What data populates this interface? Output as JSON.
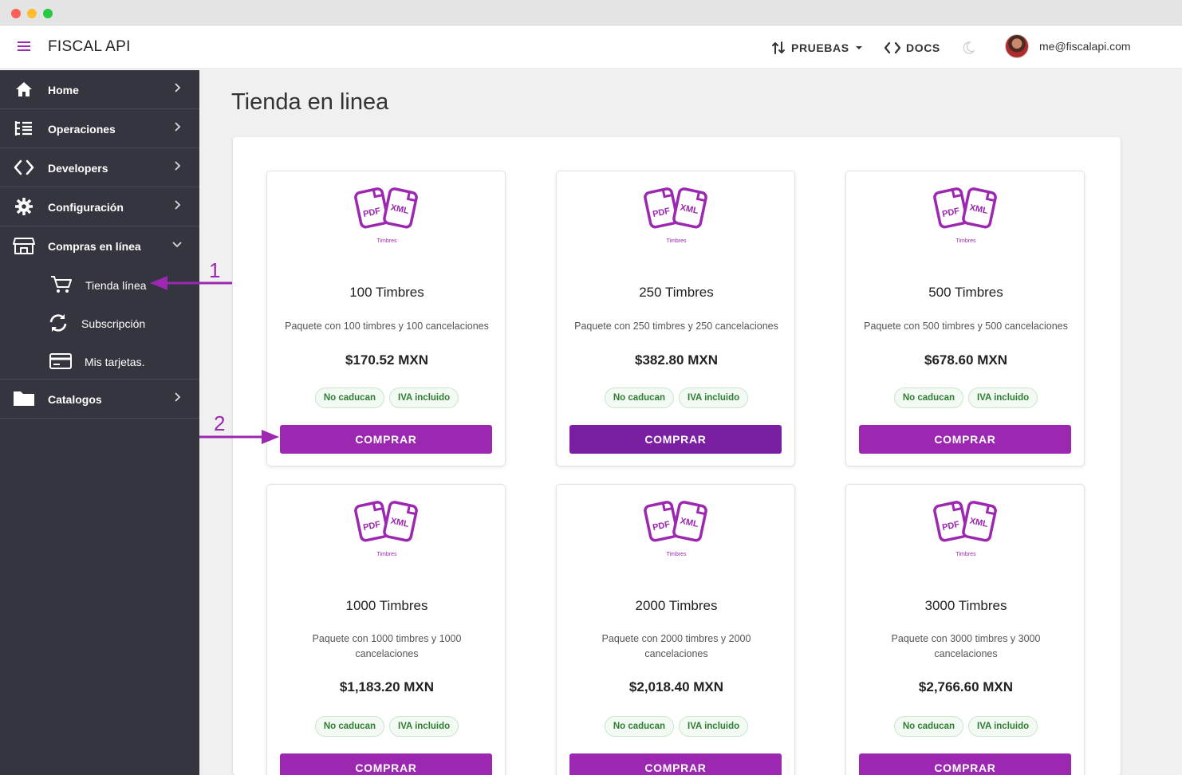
{
  "header": {
    "app_title": "FISCAL API",
    "env_label": "PRUEBAS",
    "docs_label": "DOCS",
    "user_email": "me@fiscalapi.com"
  },
  "sidebar": {
    "items": [
      {
        "label": "Home",
        "icon": "home-icon"
      },
      {
        "label": "Operaciones",
        "icon": "list-icon"
      },
      {
        "label": "Developers",
        "icon": "code-icon"
      },
      {
        "label": "Configuración",
        "icon": "gear-icon"
      },
      {
        "label": "Compras en línea",
        "icon": "store-icon",
        "expanded": true
      },
      {
        "label": "Catalogos",
        "icon": "folder-icon"
      }
    ],
    "subitems": [
      {
        "label": "Tienda línea",
        "icon": "cart-icon",
        "active": true
      },
      {
        "label": "Subscripción",
        "icon": "sync-icon"
      },
      {
        "label": "Mis tarjetas.",
        "icon": "credit-card-icon"
      }
    ]
  },
  "page": {
    "title": "Tienda en linea"
  },
  "products": [
    {
      "name": "100 Timbres",
      "description": "Paquete con 100 timbres y 100 cancelaciones",
      "price": "$170.52 MXN"
    },
    {
      "name": "250 Timbres",
      "description": "Paquete con 250 timbres y 250 cancelaciones",
      "price": "$382.80 MXN"
    },
    {
      "name": "500 Timbres",
      "description": "Paquete con 500 timbres y 500 cancelaciones",
      "price": "$678.60 MXN"
    },
    {
      "name": "1000 Timbres",
      "description": "Paquete con 1000 timbres y 1000 cancelaciones",
      "price": "$1,183.20 MXN"
    },
    {
      "name": "2000 Timbres",
      "description": "Paquete con 2000 timbres y 2000 cancelaciones",
      "price": "$2,018.40 MXN"
    },
    {
      "name": "3000 Timbres",
      "description": "Paquete con 3000 timbres y 3000 cancelaciones",
      "price": "$2,766.60 MXN"
    }
  ],
  "product_common": {
    "logo_caption": "Timbres",
    "logo_pdf": "PDF",
    "logo_xml": "XML",
    "chip_1": "No caducan",
    "chip_2": "IVA incluido",
    "buy_label": "COMPRAR"
  },
  "annotations": {
    "step_1": "1",
    "step_2": "2"
  },
  "colors": {
    "accent": "#9c27b0",
    "sidebar_bg": "#35353f",
    "chip_text": "#2e7d32"
  }
}
